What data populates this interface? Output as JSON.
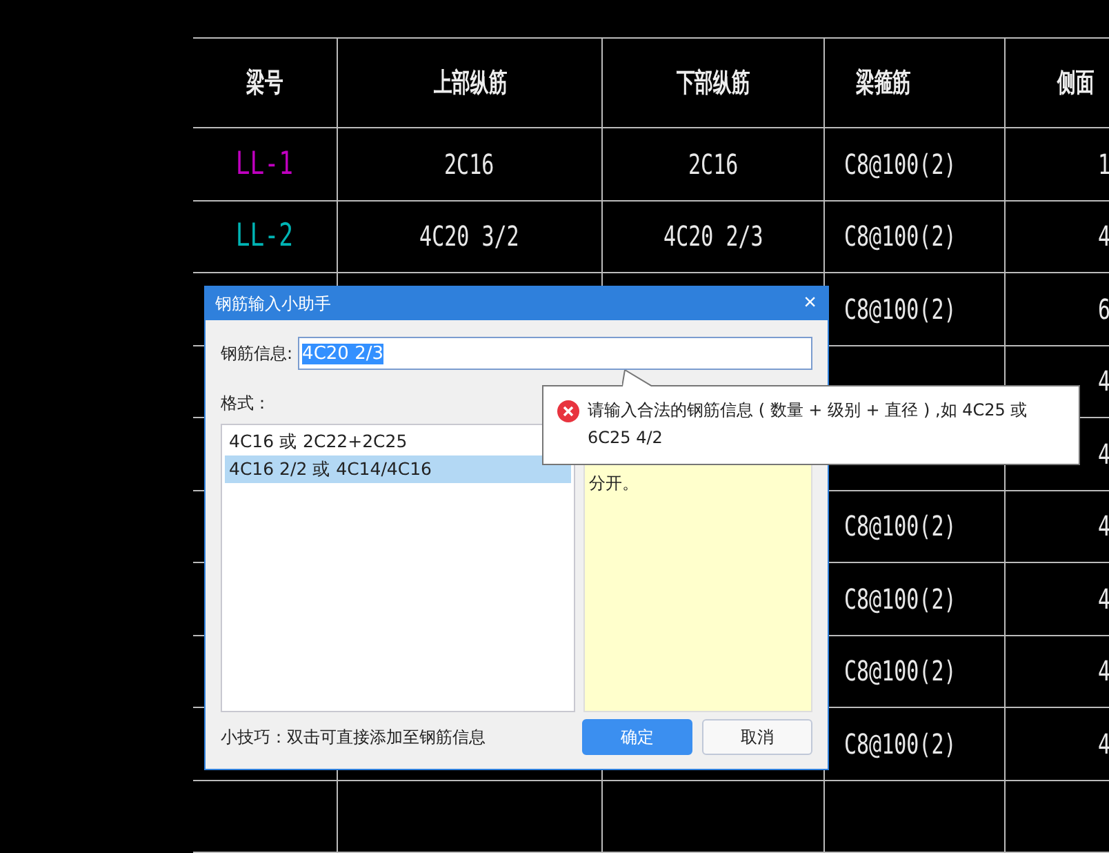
{
  "table": {
    "columns": [
      "梁号",
      "上部纵筋",
      "下部纵筋",
      "梁箍筋",
      "侧面"
    ],
    "rows": [
      {
        "beam_no": "LL-1",
        "color": "#c000c0",
        "top_bars": "2C16",
        "bottom_bars": "2C16",
        "stirrups": "C8@100(2)",
        "column_5": "1"
      },
      {
        "beam_no": "LL-2",
        "color": "#00b4b4",
        "top_bars": "4C20 3/2",
        "bottom_bars": "4C20 2/3",
        "stirrups": "C8@100(2)",
        "column_5": "4"
      },
      {
        "stirrups": "C8@100(2)",
        "column_5": "6"
      },
      {
        "column_5": "4"
      },
      {
        "column_5": "4"
      },
      {
        "stirrups": "C8@100(2)",
        "column_5": "4"
      },
      {
        "stirrups": "C8@100(2)",
        "column_5": "4"
      },
      {
        "stirrups": "C8@100(2)",
        "column_5": "4"
      },
      {
        "stirrups": "C8@100(2)",
        "column_5": "4"
      }
    ]
  },
  "dialog": {
    "title": "钢筋输入小助手",
    "close": "×",
    "field_label": "钢筋信息:",
    "field_value": "4C20 2/3",
    "format_label": "格式：",
    "formats": [
      {
        "text": "4C16 或 2C22+2C25",
        "selected": false
      },
      {
        "text": "4C16 2/2 或 4C14/4C16",
        "selected": true
      }
    ],
    "description": "分开。",
    "tip": "小技巧：双击可直接添加至钢筋信息",
    "buttons": [
      {
        "label": "确定",
        "kind": "primary"
      },
      {
        "label": "取消",
        "kind": "secondary"
      }
    ]
  },
  "tooltip": {
    "message": "请输入合法的钢筋信息 ( 数量 + 级别 + 直径 ) ,如 4C25 或 6C25 4/2"
  }
}
